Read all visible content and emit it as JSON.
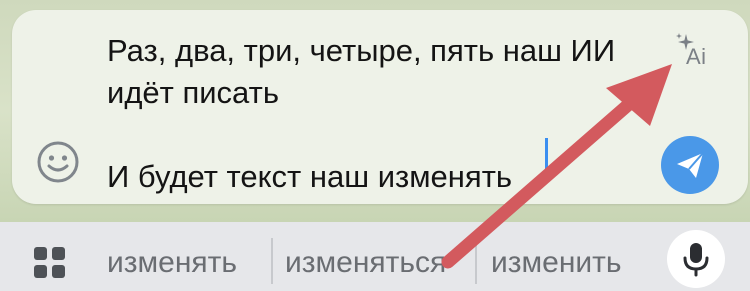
{
  "composer": {
    "text_line1": "Раз, два, три, четыре, пять наш ИИ",
    "text_line2": "идёт писать",
    "text_line3": "",
    "text_line4": "И будет текст наш изменять",
    "ai_label": "Ai",
    "emoji_icon": "smiley-icon",
    "send_icon": "paper-plane-icon",
    "ai_icon": "sparkle-icon"
  },
  "keyboard": {
    "suggestions": [
      "изменять",
      "изменяться",
      "изменить"
    ],
    "apps_icon": "grid-icon",
    "mic_icon": "microphone-icon"
  },
  "annotation": {
    "arrow_color": "#d35a5e"
  },
  "colors": {
    "send_button": "#4a98e8",
    "caret": "#3a8ef0"
  }
}
